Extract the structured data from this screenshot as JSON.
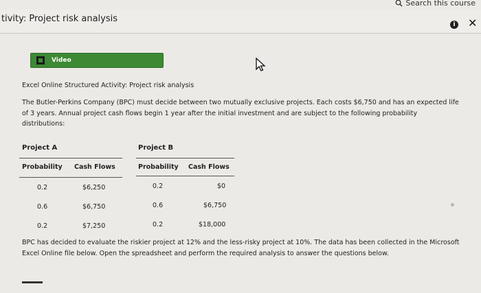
{
  "search": {
    "label": "Search this course"
  },
  "header": {
    "title": "tivity: Project risk analysis"
  },
  "video": {
    "label": "Video"
  },
  "content": {
    "heading": "Excel Online Structured Activity: Project risk analysis",
    "intro": "The Butler-Perkins Company (BPC) must decide between two mutually exclusive projects. Each costs $6,750 and has an expected life of 3 years. Annual project cash flows begin 1 year after the initial investment and are subject to the following probability distributions:",
    "conclusion": "BPC has decided to evaluate the riskier project at 12% and the less-risky project at 10%. The data has been collected in the Microsoft Excel Online file below. Open the spreadsheet and perform the required analysis to answer the questions below."
  },
  "projects": [
    {
      "name": "Project A",
      "headers": [
        "Probability",
        "Cash Flows"
      ],
      "rows": [
        {
          "probability": "0.2",
          "cash_flow": "$6,250"
        },
        {
          "probability": "0.6",
          "cash_flow": "$6,750"
        },
        {
          "probability": "0.2",
          "cash_flow": "$7,250"
        }
      ]
    },
    {
      "name": "Project B",
      "headers": [
        "Probability",
        "Cash Flows"
      ],
      "rows": [
        {
          "probability": "0.2",
          "cash_flow": "$0"
        },
        {
          "probability": "0.6",
          "cash_flow": "$6,750"
        },
        {
          "probability": "0.2",
          "cash_flow": "$18,000"
        }
      ]
    }
  ],
  "colors": {
    "video_button": "#3c8a34",
    "background": "#eceae6"
  }
}
